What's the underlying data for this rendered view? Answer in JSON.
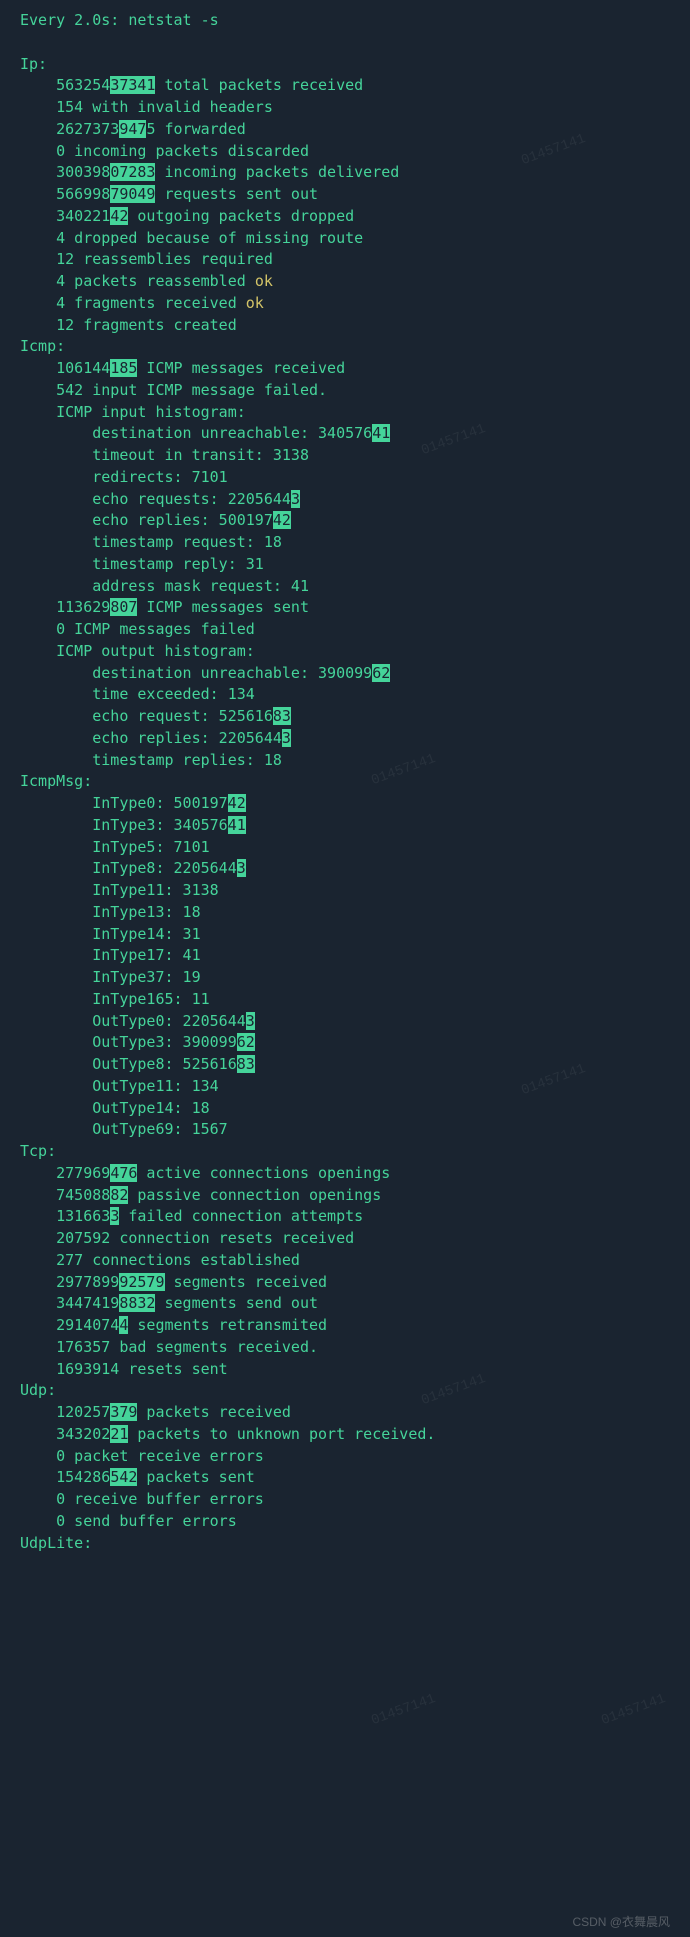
{
  "header": "Every 2.0s: netstat -s",
  "ip": {
    "title": "Ip:",
    "total_received_pre": "563254",
    "total_received_hl": "37341",
    "total_received_post": " total packets received",
    "invalid_headers": "154 with invalid headers",
    "forwarded_pre": "2627373",
    "forwarded_hl": "947",
    "forwarded_post": "5 forwarded",
    "incoming_discarded": "0 incoming packets discarded",
    "incoming_delivered_pre": "300398",
    "incoming_delivered_hl": "07283",
    "incoming_delivered_post": " incoming packets delivered",
    "requests_sent_pre": "566998",
    "requests_sent_hl": "79049",
    "requests_sent_post": " requests sent out",
    "outgoing_dropped_pre": "340221",
    "outgoing_dropped_hl": "42",
    "outgoing_dropped_post": " outgoing packets dropped",
    "dropped_missing": "4 dropped because of missing route",
    "reassemblies": "12 reassemblies required",
    "reassembled_pre": "4 packets reassembled ",
    "reassembled_ok": "ok",
    "fragments_recv_pre": "4 fragments received ",
    "fragments_recv_ok": "ok",
    "fragments_created": "12 fragments created"
  },
  "icmp": {
    "title": "Icmp:",
    "received_pre": "106144",
    "received_hl": "185",
    "received_post": " ICMP messages received",
    "input_failed": "542 input ICMP message failed.",
    "input_hist": "ICMP input histogram:",
    "dest_unreach_pre": "destination unreachable: 340576",
    "dest_unreach_hl": "41",
    "timeout_transit": "timeout in transit: 3138",
    "redirects": "redirects: 7101",
    "echo_req_pre": "echo requests: 2205644",
    "echo_req_hl": "3",
    "echo_rep_pre": "echo replies: 500197",
    "echo_rep_hl": "42",
    "ts_request": "timestamp request: 18",
    "ts_reply": "timestamp reply: 31",
    "addr_mask": "address mask request: 41",
    "sent_pre": "113629",
    "sent_hl": "807",
    "sent_post": " ICMP messages sent",
    "msgs_failed": "0 ICMP messages failed",
    "output_hist": "ICMP output histogram:",
    "out_dest_unreach_pre": "destination unreachable: 390099",
    "out_dest_unreach_hl": "62",
    "time_exceeded": "time exceeded: 134",
    "out_echo_req_pre": "echo request: 525616",
    "out_echo_req_hl": "83",
    "out_echo_rep_pre": "echo replies: 2205644",
    "out_echo_rep_hl": "3",
    "out_ts_replies": "timestamp replies: 18"
  },
  "icmpmsg": {
    "title": "IcmpMsg:",
    "in0_pre": "InType0: 500197",
    "in0_hl": "42",
    "in3_pre": "InType3: 340576",
    "in3_hl": "41",
    "in5": "InType5: 7101",
    "in8_pre": "InType8: 2205644",
    "in8_hl": "3",
    "in11": "InType11: 3138",
    "in13": "InType13: 18",
    "in14": "InType14: 31",
    "in17": "InType17: 41",
    "in37": "InType37: 19",
    "in165": "InType165: 11",
    "out0_pre": "OutType0: 2205644",
    "out0_hl": "3",
    "out3_pre": "OutType3: 390099",
    "out3_hl": "62",
    "out8_pre": "OutType8: 525616",
    "out8_hl": "83",
    "out11": "OutType11: 134",
    "out14": "OutType14: 18",
    "out69": "OutType69: 1567"
  },
  "tcp": {
    "title": "Tcp:",
    "active_pre": "277969",
    "active_hl": "476",
    "active_post": " active connections openings",
    "passive_pre": "745088",
    "passive_hl": "82",
    "passive_post": " passive connection openings",
    "failed_pre": "131663",
    "failed_hl": "3",
    "failed_post": " failed connection attempts",
    "resets_recv": "207592 connection resets received",
    "established": "277 connections established",
    "seg_recv_pre": "2977899",
    "seg_recv_hl": "92579",
    "seg_recv_post": " segments received",
    "seg_send_pre": "3447419",
    "seg_send_hl": "8832",
    "seg_send_post": " segments send out",
    "seg_retrans_pre": "2914074",
    "seg_retrans_hl": "4",
    "seg_retrans_post": " segments retransmited",
    "bad_seg": "176357 bad segments received.",
    "resets_sent": "1693914 resets sent"
  },
  "udp": {
    "title": "Udp:",
    "recv_pre": "120257",
    "recv_hl": "379",
    "recv_post": " packets received",
    "unknown_pre": "343202",
    "unknown_hl": "21",
    "unknown_post": " packets to unknown port received.",
    "recv_err": "0 packet receive errors",
    "sent_pre": "154286",
    "sent_hl": "542",
    "sent_post": " packets sent",
    "recv_buf_err": "0 receive buffer errors",
    "send_buf_err": "0 send buffer errors"
  },
  "udplite": {
    "title": "UdpLite:"
  },
  "attribution": "CSDN @衣舞晨风",
  "watermark": "01457141"
}
